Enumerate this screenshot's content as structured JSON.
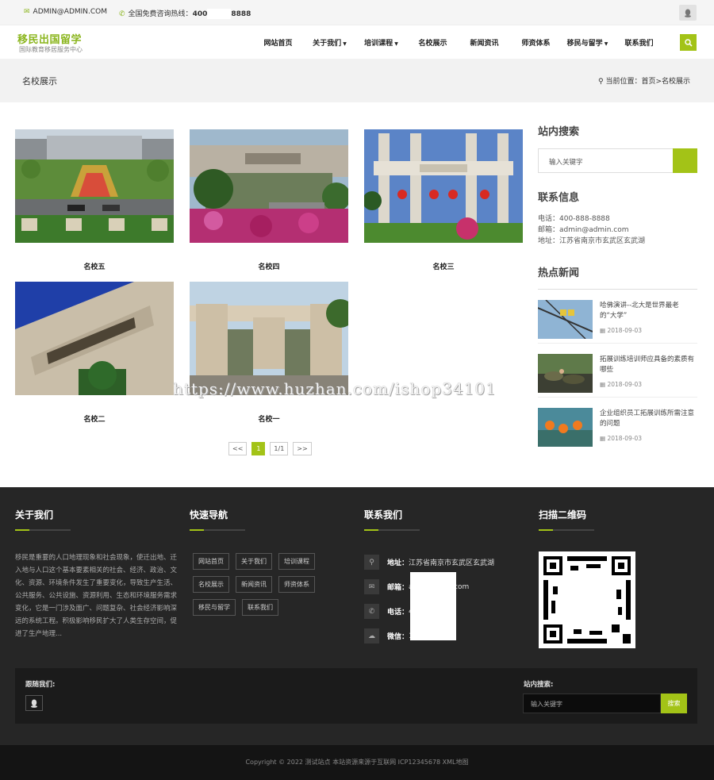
{
  "topbar": {
    "email": "ADMIN@ADMIN.COM",
    "hotline_label": "全国免费咨询热线：",
    "hotline_prefix": "400",
    "hotline_suffix": "8888"
  },
  "logo": {
    "title": "移民出国留学",
    "subtitle": "国际教育移居服务中心"
  },
  "nav": [
    {
      "label": "网站首页",
      "dropdown": false
    },
    {
      "label": "关于我们",
      "dropdown": true
    },
    {
      "label": "培训课程",
      "dropdown": true
    },
    {
      "label": "名校展示",
      "dropdown": false
    },
    {
      "label": "新闻资讯",
      "dropdown": false
    },
    {
      "label": "师资体系",
      "dropdown": false
    },
    {
      "label": "移民与留学",
      "dropdown": true
    },
    {
      "label": "联系我们",
      "dropdown": false
    }
  ],
  "banner": {
    "title": "名校展示",
    "crumb_label": "当前位置：",
    "crumb_path": "首页>名校展示"
  },
  "schools": [
    {
      "name": "名校五"
    },
    {
      "name": "名校四"
    },
    {
      "name": "名校三"
    },
    {
      "name": "名校二"
    },
    {
      "name": "名校一"
    }
  ],
  "pager": {
    "prev": "<<",
    "current": "1",
    "pages": "1/1",
    "next": ">>"
  },
  "sidebar": {
    "search_title": "站内搜索",
    "search_placeholder": "输入关键字",
    "contact_title": "联系信息",
    "contact": [
      "电话：400-888-8888",
      "邮箱：admin@admin.com",
      "地址：江苏省南京市玄武区玄武湖"
    ],
    "news_title": "热点新闻",
    "news": [
      {
        "title": "哈佛演讲--北大是世界最老的“大学”",
        "date": "2018-09-03"
      },
      {
        "title": "拓展训练培训师应具备的素质有哪些",
        "date": "2018-09-03"
      },
      {
        "title": "企业组织员工拓展训练所需注意的问题",
        "date": "2018-09-03"
      }
    ]
  },
  "watermark": "https://www.huzhan.com/ishop34101",
  "footer": {
    "about_title": "关于我们",
    "about_text": "移民是重要的人口地理现象和社会现象，使迁出地、迁入地与人口这个基本要素相关的社会、经济、政治、文化、资源、环境条件发生了重要变化，导致生产生活、公共服务、公共设施、资源利用、生态和环境服务需求变化，它是一门涉及面广、问题复杂、社会经济影响深远的系统工程。积极影响移民扩大了人类生存空间，促进了生产地理...",
    "nav_title": "快速导航",
    "nav_tags": [
      "网站首页",
      "关于我们",
      "培训课程",
      "名校展示",
      "新闻资讯",
      "师资体系",
      "移民与留学",
      "联系我们"
    ],
    "contact_title": "联系我们",
    "contact_rows": [
      {
        "icon": "map-pin-icon",
        "label": "地址：",
        "value": "江苏省南京市玄武区玄武湖"
      },
      {
        "icon": "mail-icon",
        "label": "邮箱：",
        "value": "a               n.com"
      },
      {
        "icon": "phone-icon",
        "label": "电话：",
        "value": "4"
      },
      {
        "icon": "wechat-icon",
        "label": "微信：",
        "value": "1"
      }
    ],
    "qr_title": "扫描二维码",
    "follow_label": "跟随我们:",
    "search_label": "站内搜索:",
    "search_placeholder": "输入关键字",
    "search_button": "搜索",
    "copyright": "Copyright © 2022 测试站点 本站资源来源于互联网 ICP12345678 XML地图"
  },
  "colors": {
    "accent": "#a3c317",
    "footer_bg": "#262626"
  }
}
